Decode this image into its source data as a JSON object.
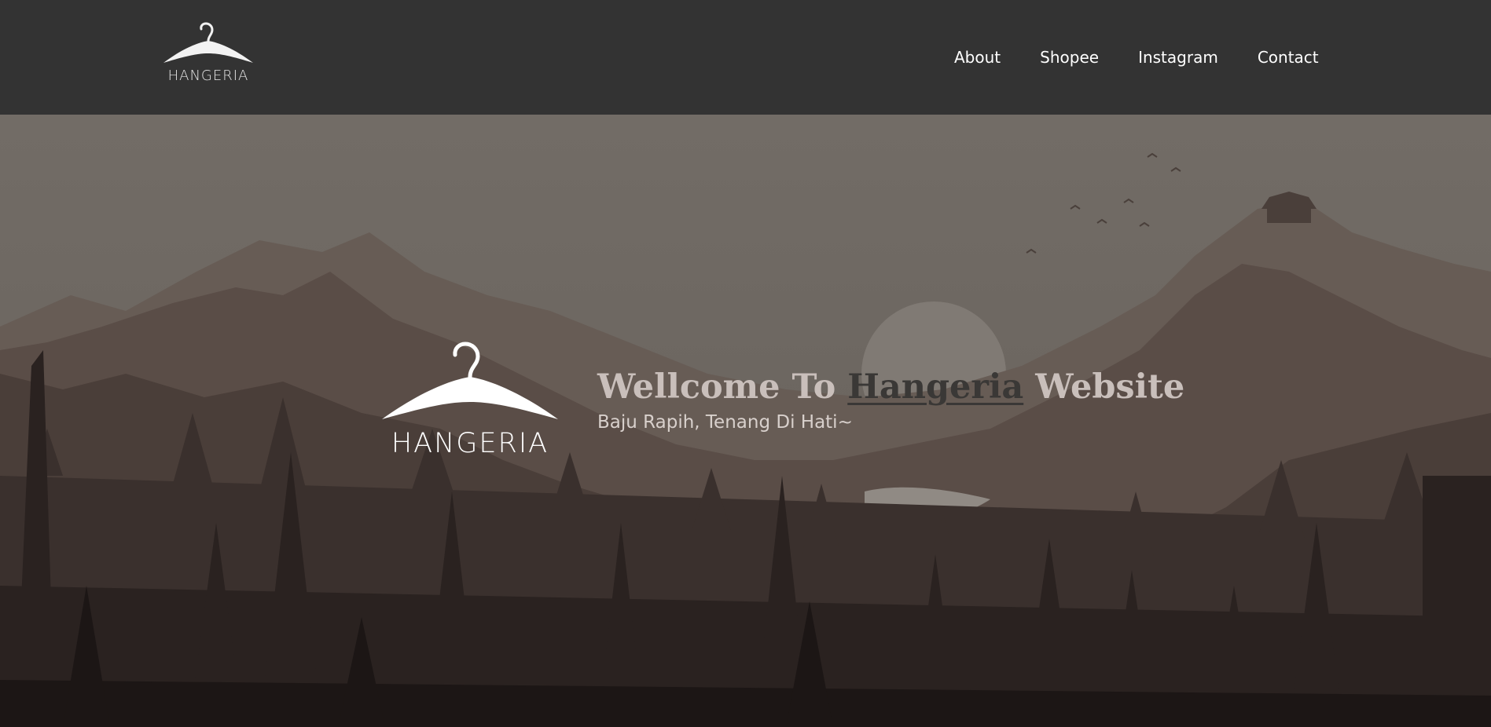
{
  "header": {
    "logo_text": "HANGERIA",
    "nav": [
      {
        "label": "About"
      },
      {
        "label": "Shopee"
      },
      {
        "label": "Instagram"
      },
      {
        "label": "Contact"
      }
    ]
  },
  "hero": {
    "logo_text": "HANGERIA",
    "title_prefix": "Wellcome To ",
    "title_brand": "Hangeria",
    "title_suffix": " Website",
    "subtitle": "Baju Rapih, Tenang Di Hati~"
  },
  "colors": {
    "header_bg": "#333333",
    "nav_text": "#ffffff",
    "title_text": "#c9bfbb",
    "brand_word": "#3a3836"
  }
}
